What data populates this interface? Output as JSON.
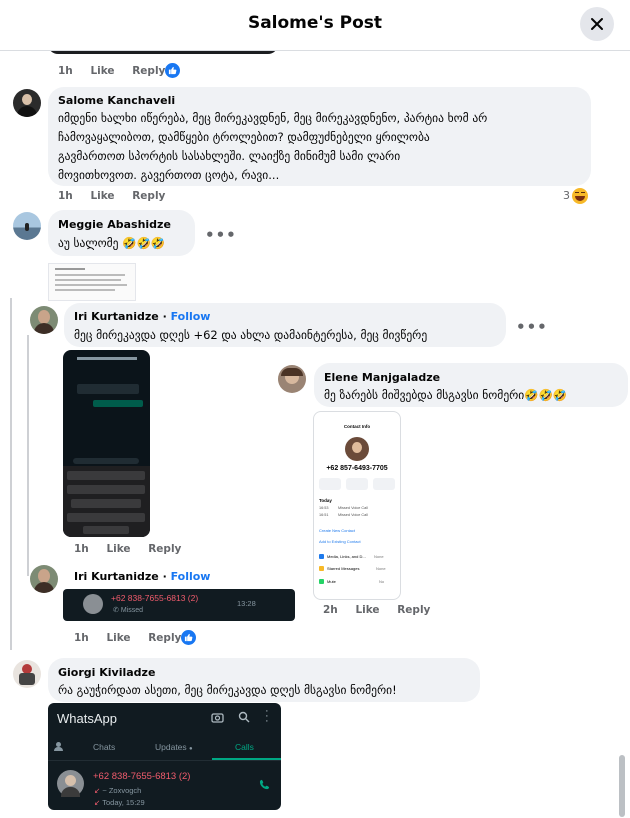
{
  "header": {
    "title": "Salome's Post",
    "close_icon": "close-icon"
  },
  "top_meta": {
    "time": "1h",
    "like": "Like",
    "reply": "Reply"
  },
  "comments": [
    {
      "name": "Salome Kanchaveli",
      "text_lines": [
        "იმდენი ხალხი იწერება, მეც მირეკავდნენ, მეც მირეკავდნენო, პარტია ხომ არ",
        "ჩამოვაყალიბოთ, დამწყები ტროლებით? დამფუძნებელი ყრილობა",
        "გავმართოთ სპორტის სასახლეში. ლაიქზე მინიმუმ სამი ლარი",
        "მოვითხოვოთ. გავერთოთ ცოტა, რავი..."
      ],
      "time": "1h",
      "like": "Like",
      "reply": "Reply",
      "reaction_count": "3"
    },
    {
      "name": "Meggie Abashidze",
      "text": "აუ სალომე 🤣🤣🤣"
    },
    {
      "name": "Iri Kurtanidze",
      "separator": " · ",
      "follow": "Follow",
      "text": "მეც მირეკავდა დღეს +62 და ახლა დამაინტერესა, მეც მივწერე",
      "time": "1h",
      "like": "Like",
      "reply": "Reply"
    },
    {
      "name": "Elene Manjgaladze",
      "text": "მე ზარებს მიშვებდა მსგავსი ნომერი🤣🤣🤣",
      "time": "2h",
      "like": "Like",
      "reply": "Reply"
    },
    {
      "name": "Iri Kurtanidze",
      "separator": " · ",
      "follow": "Follow",
      "time": "1h",
      "like": "Like",
      "reply": "Reply"
    },
    {
      "name": "Giorgi Kiviladze",
      "text": "რა გაუჭირდათ ასეთი, მეც მირეკავდა დღეს მსგავსი ნომერი!"
    }
  ],
  "missed_call": {
    "number": "+62 838-7655-6813 (2)",
    "label": "Missed",
    "time": "13:28"
  },
  "contact_info": {
    "title": "Contact Info",
    "number": "+62 857-6493-7705",
    "actions": [
      "message",
      "audio",
      "video"
    ],
    "day": "Today",
    "calls": [
      "Missed Voice Call",
      "Missed Voice Call"
    ],
    "times": [
      "16:53",
      "16:51"
    ],
    "links": [
      "Create New Contact",
      "Add to Existing Contact"
    ],
    "rows": [
      "Media, Links, and D...",
      "Starred Messages",
      "Mute"
    ],
    "row_values": [
      "None",
      "None",
      "No"
    ]
  },
  "whatsapp": {
    "app": "WhatsApp",
    "tabs": [
      "Chats",
      "Updates",
      "Calls"
    ],
    "active_tab": "Calls",
    "call_number": "+62 838-7655-6813 (2)",
    "call_name": "~ Zoxvogch",
    "call_time": "Today, 15:29",
    "accent": "#25d366",
    "missed_color": "#f15c6d"
  },
  "icons": {
    "like": "thumbs-up-icon",
    "laugh": "laughing-emoji-icon",
    "more": "more-dots-icon"
  }
}
